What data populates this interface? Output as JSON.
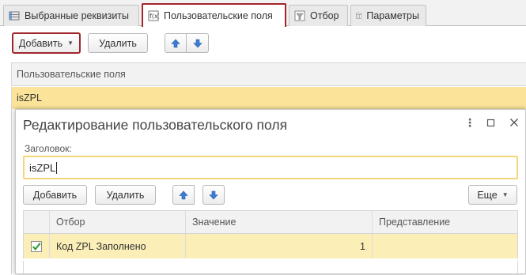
{
  "tabs": [
    {
      "label": "Выбранные реквизиты",
      "icon": "list-icon",
      "active": false
    },
    {
      "label": "Пользовательские поля",
      "icon": "formula-icon",
      "active": true
    },
    {
      "label": "Отбор",
      "icon": "filter-icon",
      "active": false
    },
    {
      "label": "Параметры",
      "icon": "table-icon",
      "active": false
    }
  ],
  "toolbar": {
    "add_label": "Добавить",
    "delete_label": "Удалить"
  },
  "list": {
    "header": "Пользовательские поля",
    "rows": [
      "isZPL"
    ]
  },
  "dialog": {
    "title": "Редактирование пользовательского поля",
    "field_label": "Заголовок:",
    "field_value": "isZPL",
    "toolbar": {
      "add_label": "Добавить",
      "delete_label": "Удалить",
      "more_label": "Еще"
    },
    "table": {
      "columns": [
        "Отбор",
        "Значение",
        "Представление"
      ],
      "rows": [
        {
          "checked": true,
          "filter": "Код ZPL Заполнено",
          "value": "1",
          "presentation": ""
        }
      ]
    }
  },
  "colors": {
    "accent_red": "#a0262b",
    "selection_yellow": "#fbe499",
    "arrow_blue": "#3a7bd5",
    "check_green": "#2e9b2e"
  }
}
